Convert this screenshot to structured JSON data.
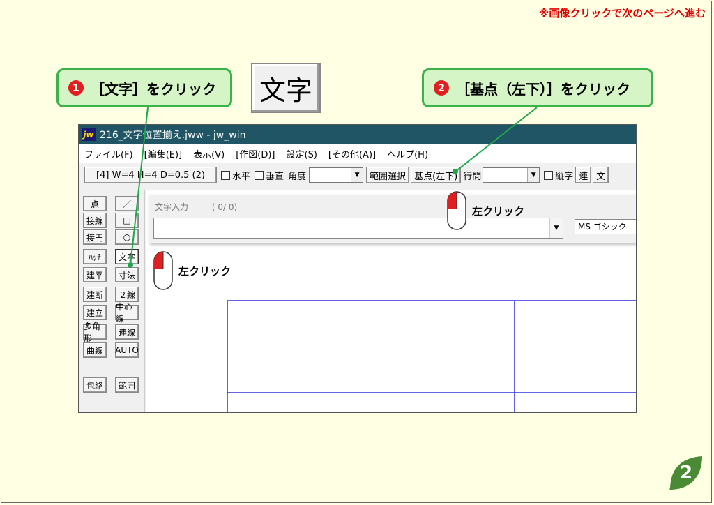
{
  "header": {
    "next_note": "※画像クリックで次のページへ進む"
  },
  "callouts": [
    {
      "num": "1",
      "text": "［文字］をクリック"
    },
    {
      "num": "2",
      "text": "［基点（左下）］をクリック"
    }
  ],
  "featured_button": {
    "label": "文字"
  },
  "window": {
    "title": "216_文字位置揃え.jww - jw_win",
    "logo": "jw",
    "menu": [
      "ファイル(F)",
      "[編集(E)]",
      "表示(V)",
      "[作図(D)]",
      "設定(S)",
      "[その他(A)]",
      "ヘルプ(H)"
    ]
  },
  "toolbar": {
    "size_label": "[4]  W=4  H=4  D=0.5 (2)",
    "horizontal": "水平",
    "vertical": "垂直",
    "angle": "角度",
    "range_select": "範囲選択",
    "base_point": "基点(左下)",
    "line_spacing": "行間",
    "vertical_text": "縦字",
    "continuous": "連",
    "text_short": "文"
  },
  "tools_left": [
    "点",
    "接線",
    "接円",
    "ﾊｯﾁ",
    "建平",
    "建断",
    "建立",
    "多角形",
    "曲線",
    "包絡"
  ],
  "tools_right": [
    "／",
    "□",
    "○",
    "文字",
    "寸法",
    "２線",
    "中心線",
    "連線",
    "AUTO",
    "範囲"
  ],
  "text_dialog": {
    "label": "文字入力",
    "counter": "( 0/  0)",
    "font": "MS ゴシック"
  },
  "hints": {
    "left_click": "左クリック"
  },
  "page_number": "2",
  "colors": {
    "accent_green": "#3bb34a",
    "callout_bg": "#d6f5c6",
    "title_bar": "#1f5564",
    "drawing_line": "#3030dd"
  }
}
